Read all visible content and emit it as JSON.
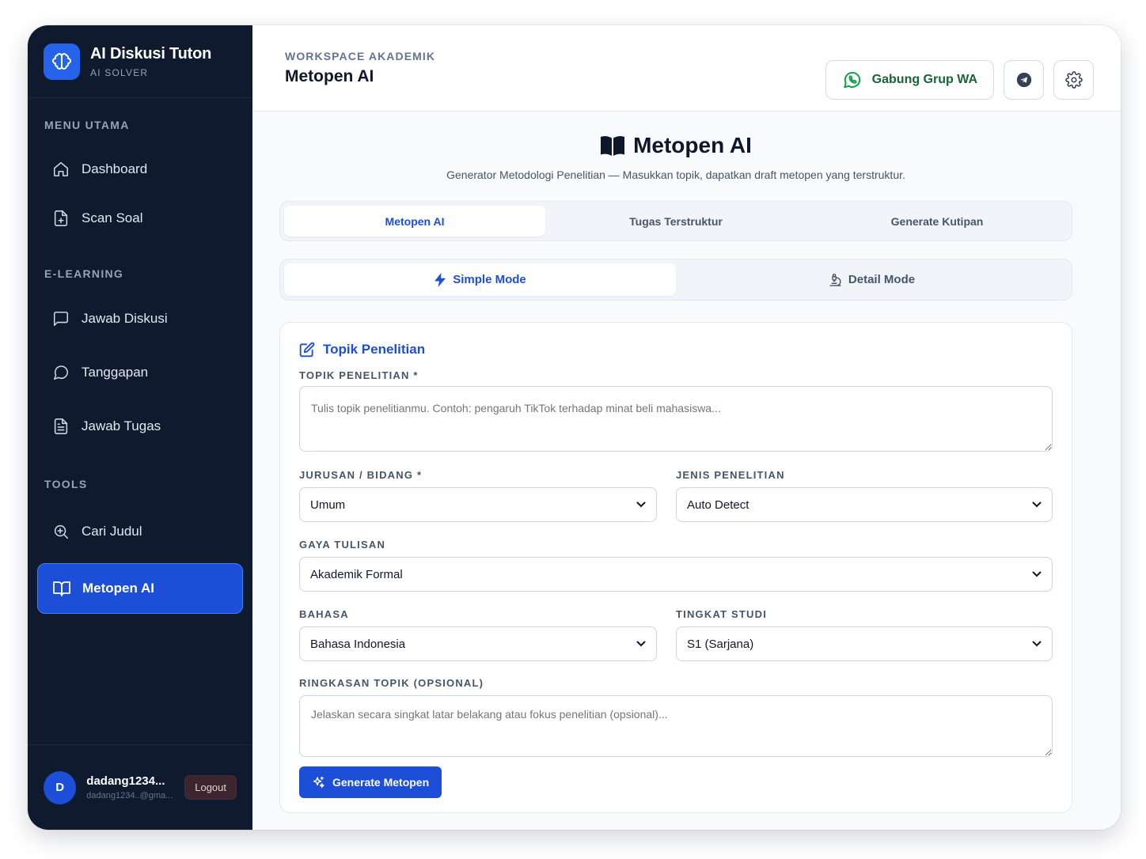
{
  "brand": {
    "title": "AI Diskusi Tuton",
    "subtitle": "AI SOLVER"
  },
  "sidebar": {
    "sections": [
      {
        "label": "MENU UTAMA"
      },
      {
        "label": "E-LEARNING"
      },
      {
        "label": "TOOLS"
      }
    ],
    "items": [
      {
        "label": "Dashboard",
        "icon": "home-icon"
      },
      {
        "label": "Scan Soal",
        "icon": "file-plus-icon"
      },
      {
        "label": "Jawab Diskusi",
        "icon": "chat-square-icon"
      },
      {
        "label": "Tanggapan",
        "icon": "chat-bubble-icon"
      },
      {
        "label": "Jawab Tugas",
        "icon": "document-icon"
      },
      {
        "label": "Cari Judul",
        "icon": "search-zoom-icon"
      },
      {
        "label": "Metopen AI",
        "icon": "book-open-icon",
        "active": true
      }
    ]
  },
  "user": {
    "initial": "D",
    "name": "dadang1234...",
    "email": "dadang1234..@gma...",
    "logout_label": "Logout"
  },
  "header": {
    "crumb": "WORKSPACE AKADEMIK",
    "title": "Metopen AI",
    "wa_label": "Gabung Grup WA"
  },
  "hero": {
    "title": "Metopen AI",
    "subtitle": "Generator Metodologi Penelitian — Masukkan topik, dapatkan draft metopen yang terstruktur."
  },
  "tabs": [
    {
      "label": "Metopen AI",
      "active": true
    },
    {
      "label": "Tugas Terstruktur"
    },
    {
      "label": "Generate Kutipan"
    }
  ],
  "modes": [
    {
      "label": "Simple Mode",
      "active": true
    },
    {
      "label": "Detail Mode"
    }
  ],
  "form": {
    "card_title": "Topik Penelitian",
    "topik_label": "TOPIK PENELITIAN *",
    "topik_placeholder": "Tulis topik penelitianmu. Contoh: pengaruh TikTok terhadap minat beli mahasiswa...",
    "jurusan_label": "JURUSAN / BIDANG *",
    "jurusan_value": "Umum",
    "jenis_label": "JENIS PENELITIAN",
    "jenis_value": "Auto Detect",
    "gaya_label": "GAYA TULISAN",
    "gaya_value": "Akademik Formal",
    "bahasa_label": "BAHASA",
    "bahasa_value": "Bahasa Indonesia",
    "tingkat_label": "TINGKAT STUDI",
    "tingkat_value": "S1 (Sarjana)",
    "ringkasan_label": "RINGKASAN TOPIK (OPSIONAL)",
    "ringkasan_placeholder": "Jelaskan secara singkat latar belakang atau fokus penelitian (opsional)...",
    "generate_label": "Generate Metopen"
  },
  "colors": {
    "sidebar_bg": "#0f1a2f",
    "accent": "#1d4ed8",
    "whatsapp": "#16a34a"
  }
}
